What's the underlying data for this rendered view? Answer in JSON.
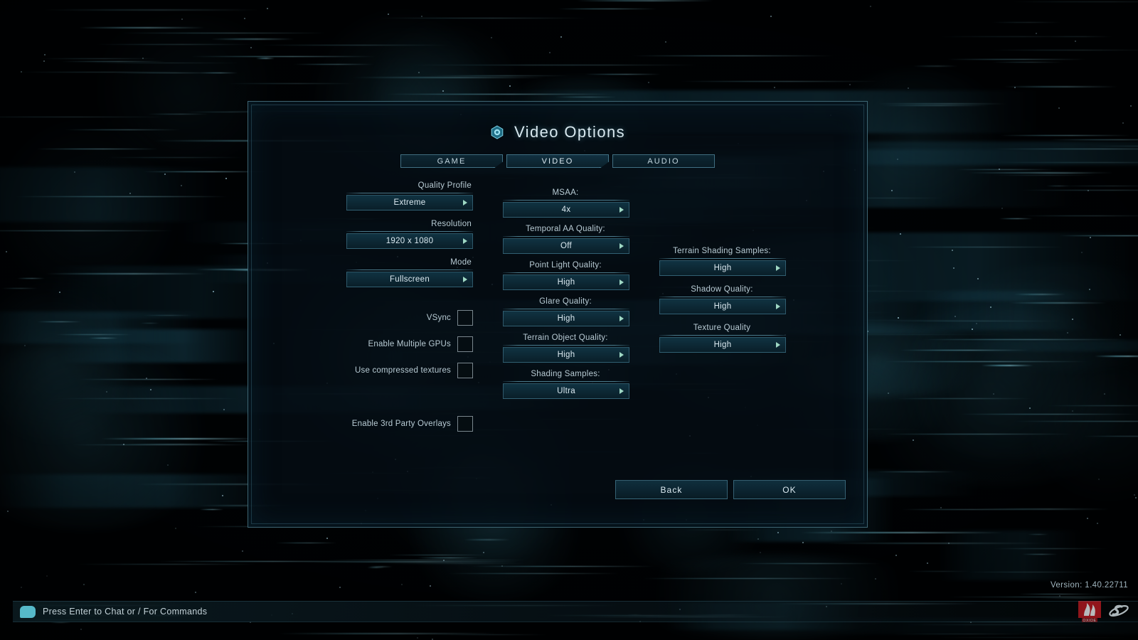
{
  "window": {
    "title": "Video Options",
    "title_icon": "hex-orb-icon"
  },
  "tabs": [
    {
      "label": "GAME",
      "active": false
    },
    {
      "label": "VIDEO",
      "active": true
    },
    {
      "label": "AUDIO",
      "active": false
    }
  ],
  "columns": {
    "left": {
      "dropdowns": [
        {
          "label": "Quality Profile",
          "value": "Extreme"
        },
        {
          "label": "Resolution",
          "value": "1920 x 1080"
        },
        {
          "label": "Mode",
          "value": "Fullscreen"
        }
      ],
      "checkboxes": [
        {
          "label": "VSync",
          "checked": false
        },
        {
          "label": "Enable Multiple GPUs",
          "checked": false
        },
        {
          "label": "Use compressed textures",
          "checked": false
        },
        {
          "label": "Enable 3rd Party Overlays",
          "checked": false
        }
      ]
    },
    "middle": {
      "dropdowns": [
        {
          "label": "MSAA:",
          "value": "4x"
        },
        {
          "label": "Temporal AA Quality:",
          "value": "Off"
        },
        {
          "label": "Point Light Quality:",
          "value": "High"
        },
        {
          "label": "Glare Quality:",
          "value": "High"
        },
        {
          "label": "Terrain Object Quality:",
          "value": "High"
        },
        {
          "label": "Shading Samples:",
          "value": "Ultra"
        }
      ]
    },
    "right": {
      "dropdowns": [
        {
          "label": "Terrain Shading Samples:",
          "value": "High"
        },
        {
          "label": "Shadow Quality:",
          "value": "High"
        },
        {
          "label": "Texture Quality",
          "value": "High"
        }
      ]
    }
  },
  "actions": [
    {
      "label": "Back"
    },
    {
      "label": "OK"
    }
  ],
  "hud": {
    "version": "Version: 1.40.22711",
    "chat_hint": "Press Enter to Chat or / For Commands",
    "chat_icon": "chat-bubble-icon",
    "logos": [
      {
        "name": "oxide-games-logo",
        "text": "OXIDE"
      },
      {
        "name": "stardock-logo",
        "text": "S"
      }
    ]
  },
  "colors": {
    "accent": "#78c3dc",
    "panel_bg": "#040d13",
    "text": "#dbe9f0",
    "label": "#b8cbd4",
    "arrow": "#9fd8c4",
    "oxide_red": "#c8161d",
    "chat_cyan": "#56b9c9"
  }
}
